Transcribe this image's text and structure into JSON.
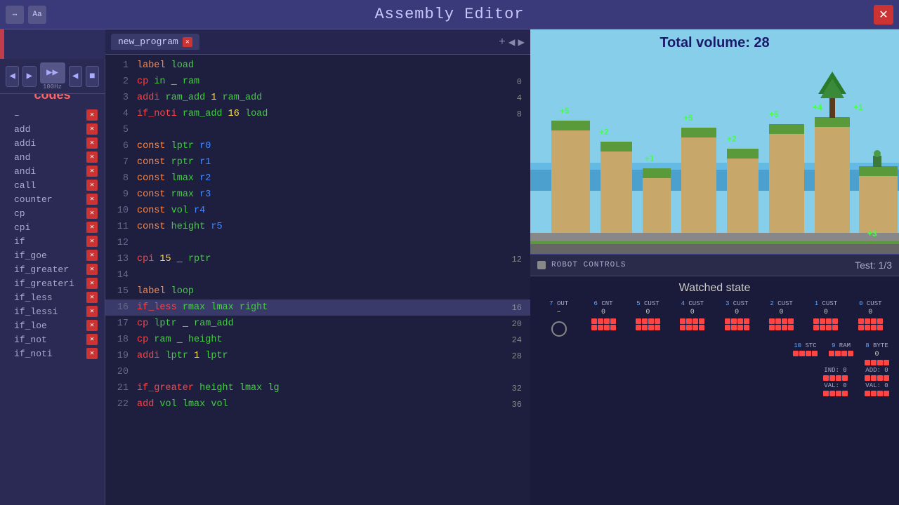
{
  "titleBar": {
    "title": "Assembly Editor",
    "closeLabel": "✕"
  },
  "toolbar": {
    "speed": "100Hz",
    "buttons": [
      "▶",
      "▶▶",
      "■",
      "◀",
      "■"
    ]
  },
  "tabs": {
    "active": "new_program",
    "items": [
      {
        "label": "new_program"
      }
    ]
  },
  "sidebar": {
    "title": "Assembly codes",
    "items": [
      {
        "label": "–"
      },
      {
        "label": "add"
      },
      {
        "label": "addi"
      },
      {
        "label": "and"
      },
      {
        "label": "andi"
      },
      {
        "label": "call"
      },
      {
        "label": "counter"
      },
      {
        "label": "cp"
      },
      {
        "label": "cpi"
      },
      {
        "label": "if"
      },
      {
        "label": "if_goe"
      },
      {
        "label": "if_greater"
      },
      {
        "label": "if_greateri"
      },
      {
        "label": "if_less"
      },
      {
        "label": "if_lessi"
      },
      {
        "label": "if_loe"
      },
      {
        "label": "if_not"
      },
      {
        "label": "if_noti"
      }
    ]
  },
  "editor": {
    "lines": [
      {
        "num": 1,
        "content": "label load",
        "val": "",
        "type": "label"
      },
      {
        "num": 2,
        "content": "cp in _ ram",
        "val": "0",
        "type": "cmd"
      },
      {
        "num": 3,
        "content": "addi ram_add 1 ram_add",
        "val": "4",
        "type": "cmd"
      },
      {
        "num": 4,
        "content": "if_noti ram_add 16 load",
        "val": "8",
        "type": "cmd"
      },
      {
        "num": 5,
        "content": "",
        "val": "",
        "type": "blank"
      },
      {
        "num": 6,
        "content": "const lptr r0",
        "val": "",
        "type": "const"
      },
      {
        "num": 7,
        "content": "const rptr r1",
        "val": "",
        "type": "const"
      },
      {
        "num": 8,
        "content": "const lmax r2",
        "val": "",
        "type": "const"
      },
      {
        "num": 9,
        "content": "const rmax r3",
        "val": "",
        "type": "const"
      },
      {
        "num": 10,
        "content": "const vol r4",
        "val": "",
        "type": "const"
      },
      {
        "num": 11,
        "content": "const height r5",
        "val": "",
        "type": "const"
      },
      {
        "num": 12,
        "content": "",
        "val": "",
        "type": "blank"
      },
      {
        "num": 13,
        "content": "cpi 15 _ rptr",
        "val": "12",
        "type": "cmd"
      },
      {
        "num": 14,
        "content": "",
        "val": "",
        "type": "blank"
      },
      {
        "num": 15,
        "content": "label loop",
        "val": "",
        "type": "label"
      },
      {
        "num": 16,
        "content": "if_less rmax lmax right",
        "val": "16",
        "type": "active"
      },
      {
        "num": 17,
        "content": "cp lptr _ ram_add",
        "val": "20",
        "type": "cmd"
      },
      {
        "num": 18,
        "content": "cp ram _ height",
        "val": "24",
        "type": "cmd"
      },
      {
        "num": 19,
        "content": "addi lptr 1 lptr",
        "val": "28",
        "type": "cmd"
      },
      {
        "num": 20,
        "content": "",
        "val": "",
        "type": "blank"
      },
      {
        "num": 21,
        "content": "if_greater height lmax lg",
        "val": "32",
        "type": "cmd"
      },
      {
        "num": 22,
        "content": "add vol lmax vol",
        "val": "36",
        "type": "cmd"
      }
    ]
  },
  "gameView": {
    "totalVolume": "Total volume: 28",
    "scores": [
      "+5",
      "+2",
      "+1",
      "+5",
      "+2",
      "+5",
      "+4",
      "+1",
      "+3"
    ]
  },
  "robotControls": {
    "label": "ROBOT CONTROLS",
    "test": "Test: 1/3"
  },
  "watchedState": {
    "title": "Watched state",
    "columns": [
      {
        "label": "7 OUT",
        "num": "",
        "value": "–"
      },
      {
        "label": "6 CNT",
        "num": "",
        "value": "0"
      },
      {
        "label": "5 CUST",
        "num": "",
        "value": "0"
      },
      {
        "label": "4 CUST",
        "num": "",
        "value": "0"
      },
      {
        "label": "3 CUST",
        "num": "",
        "value": "0"
      },
      {
        "label": "2 CUST",
        "num": "",
        "value": "0"
      },
      {
        "label": "1 CUST",
        "num": "",
        "value": "0"
      },
      {
        "label": "0 CUST",
        "num": "",
        "value": "0"
      }
    ],
    "bottomCols": [
      {
        "label": "10 STC",
        "value": ""
      },
      {
        "label": "9 RAM",
        "value": ""
      },
      {
        "label": "8 BYTE",
        "value": "0"
      }
    ],
    "indVal": [
      {
        "label": "IND: 0",
        "value": ""
      },
      {
        "label": "ADD: 0",
        "value": ""
      }
    ],
    "val": [
      {
        "label": "VAL: 0",
        "value": ""
      },
      {
        "label": "VAL: 0",
        "value": ""
      }
    ]
  }
}
